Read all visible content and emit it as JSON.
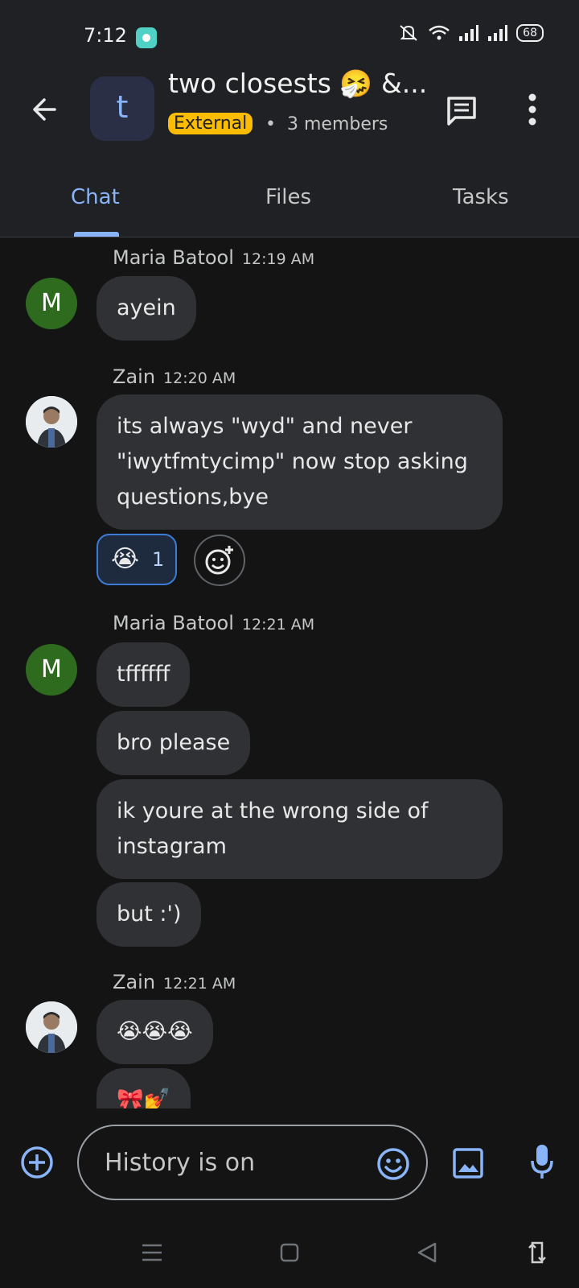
{
  "status_bar": {
    "time": "7:12",
    "battery": "68"
  },
  "header": {
    "avatar_letter": "t",
    "title": "two closests 🤧 &...",
    "badge": "External",
    "separator": "•",
    "members": "3 members"
  },
  "tabs": [
    "Chat",
    "Files",
    "Tasks"
  ],
  "messages": [
    {
      "sender": "Maria Batool",
      "time": "12:19 AM",
      "avatar_letter": "M",
      "bubbles": [
        "ayein"
      ]
    },
    {
      "sender": "Zain",
      "time": "12:20 AM",
      "bubbles": [
        "its always \"wyd\" and never \"iwytfmtycimp\" now stop asking questions,bye"
      ],
      "reaction": {
        "emoji": "😭",
        "count": "1"
      }
    },
    {
      "sender": "Maria Batool",
      "time": "12:21 AM",
      "avatar_letter": "M",
      "bubbles": [
        "tffffff",
        "bro please",
        "ik youre at the wrong side of instagram",
        "but :')"
      ]
    },
    {
      "sender": "Zain",
      "time": "12:21 AM",
      "bubbles": [
        "😭😭😭",
        "🎀💅"
      ]
    }
  ],
  "composer": {
    "placeholder": "History is on"
  }
}
